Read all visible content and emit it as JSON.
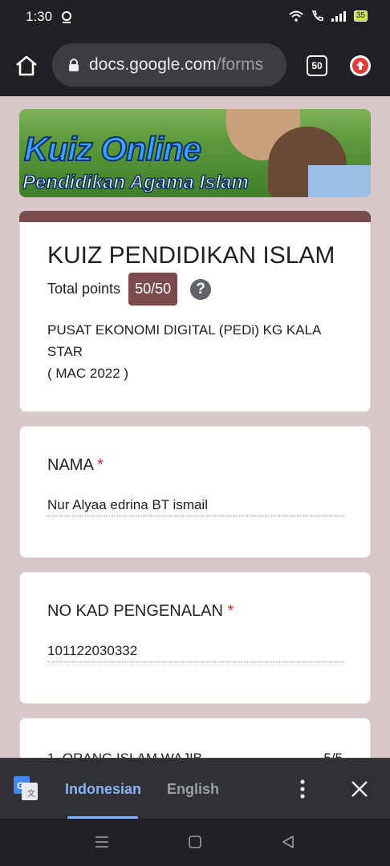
{
  "status_bar": {
    "time": "1:30",
    "battery": "35"
  },
  "browser": {
    "url_host": "docs.google.com",
    "url_path": "/forms",
    "tab_count": "50"
  },
  "banner": {
    "title": "Kuiz Online",
    "subtitle": "Pendidikan Agama Islam"
  },
  "form_header": {
    "title": "KUIZ PENDIDIKAN ISLAM",
    "points_label": "Total points",
    "points_value": "50/50",
    "description": "PUSAT EKONOMI DIGITAL (PEDi) KG KALA\nSTAR\n( MAC 2022 )"
  },
  "questions": [
    {
      "title": "NAMA",
      "required_mark": "*",
      "answer": "Nur Alyaa edrina BT ismail"
    },
    {
      "title": "NO KAD PENGENALAN",
      "required_mark": "*",
      "answer": "101122030332"
    },
    {
      "title": "1. ORANG ISLAM WAJIB",
      "score": "5/5"
    }
  ],
  "translate_bar": {
    "lang_active": "Indonesian",
    "lang_other": "English"
  },
  "colors": {
    "accent": "#7b4a4a",
    "page_bg": "#d9c8c8",
    "translate_active": "#8ab4f8"
  }
}
